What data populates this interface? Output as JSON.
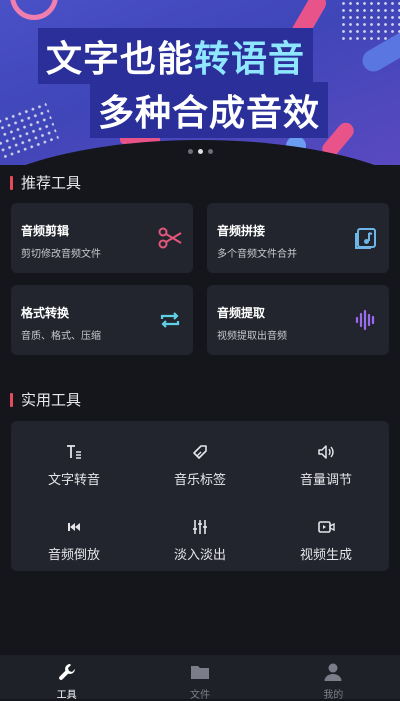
{
  "banner": {
    "line1_part1": "文字也能",
    "line1_part2": "转语音",
    "line2": "多种合成音效",
    "slides": 3,
    "active_slide": 2
  },
  "section1": {
    "title": "推荐工具"
  },
  "cards": [
    {
      "title": "音频剪辑",
      "subtitle": "剪切修改音频文件",
      "icon": "scissors-icon",
      "color": "#e2587a"
    },
    {
      "title": "音频拼接",
      "subtitle": "多个音频文件合并",
      "icon": "music-file-icon",
      "color": "#6cb6e8"
    },
    {
      "title": "格式转换",
      "subtitle": "音质、格式、压缩",
      "icon": "convert-icon",
      "color": "#5fd0e6"
    },
    {
      "title": "音频提取",
      "subtitle": "视频提取出音频",
      "icon": "waveform-icon",
      "color": "#9b6cf0"
    }
  ],
  "section2": {
    "title": "实用工具"
  },
  "tools": [
    {
      "label": "文字转音",
      "icon": "text-icon"
    },
    {
      "label": "音乐标签",
      "icon": "tag-icon"
    },
    {
      "label": "音量调节",
      "icon": "volume-icon"
    },
    {
      "label": "音频倒放",
      "icon": "rewind-icon"
    },
    {
      "label": "淡入淡出",
      "icon": "sliders-icon"
    },
    {
      "label": "视频生成",
      "icon": "video-icon"
    }
  ],
  "tabbar": [
    {
      "label": "工具",
      "icon": "wrench-icon",
      "active": true
    },
    {
      "label": "文件",
      "icon": "folder-icon",
      "active": false
    },
    {
      "label": "我的",
      "icon": "user-icon",
      "active": false
    }
  ]
}
